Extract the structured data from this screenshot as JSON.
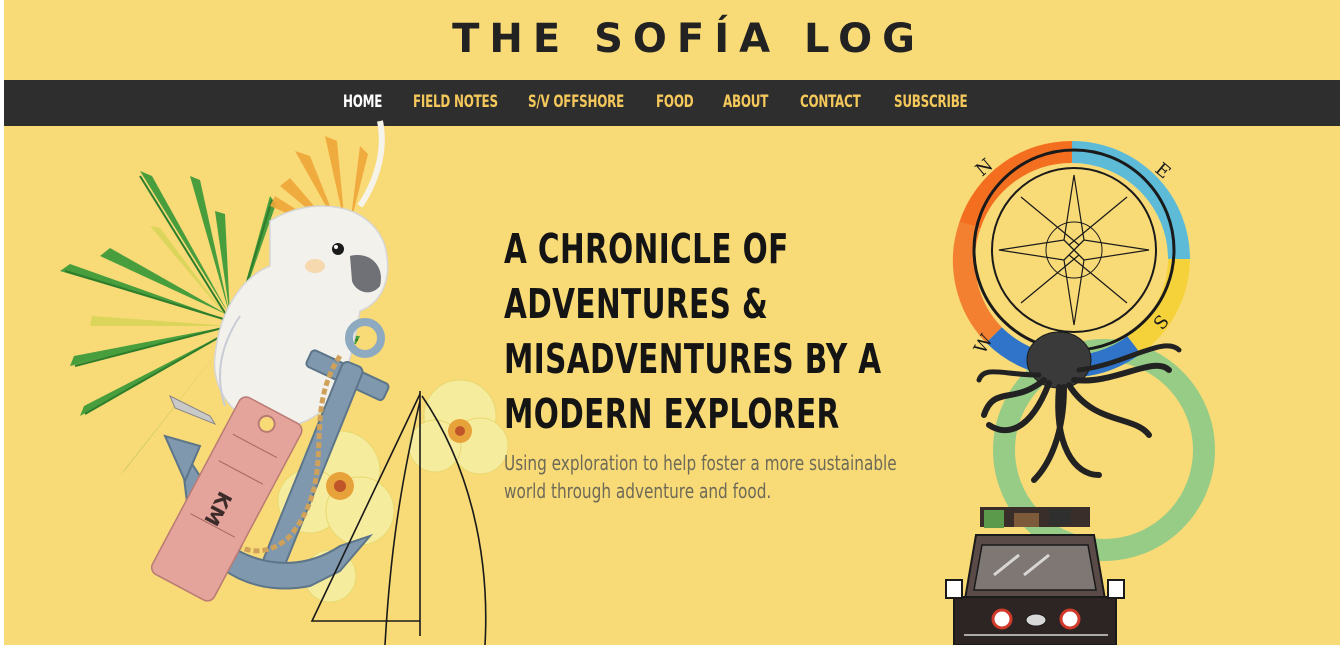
{
  "site": {
    "title": "THE SOFÍA LOG"
  },
  "nav": {
    "items": [
      {
        "label": "HOME",
        "active": true
      },
      {
        "label": "FIELD NOTES",
        "active": false
      },
      {
        "label": "S/V OFFSHORE",
        "active": false
      },
      {
        "label": "FOOD",
        "active": false
      },
      {
        "label": "ABOUT",
        "active": false
      },
      {
        "label": "CONTACT",
        "active": false
      },
      {
        "label": "SUBSCRIBE",
        "active": false
      }
    ]
  },
  "hero": {
    "headline": "A CHRONICLE OF ADVENTURES & MISADVENTURES BY A MODERN EXPLORER",
    "headline_lines": [
      "A CHRONICLE OF",
      "ADVENTURES &",
      "MISADVENTURES BY A",
      "MODERN EXPLORER"
    ],
    "tagline_lines": [
      "Using exploration to help foster a more sustainable",
      "world through adventure and food."
    ]
  },
  "compass": {
    "letters": [
      "N",
      "E",
      "S",
      "W"
    ]
  },
  "luggage_tag": {
    "text": "KM"
  },
  "colors": {
    "background": "#f8da77",
    "nav_bg": "#2e2e2e",
    "nav_text": "#f4c85a",
    "nav_active": "#ffffff",
    "headline": "#141414",
    "tagline": "#6e6a58"
  },
  "icons": [
    "cockatoo-illustration",
    "palm-leaves-illustration",
    "anchor-illustration",
    "luggage-tag-illustration",
    "hibiscus-flower-illustration",
    "sailboat-sketch",
    "compass-rose-illustration",
    "octopus-illustration",
    "land-cruiser-illustration"
  ]
}
